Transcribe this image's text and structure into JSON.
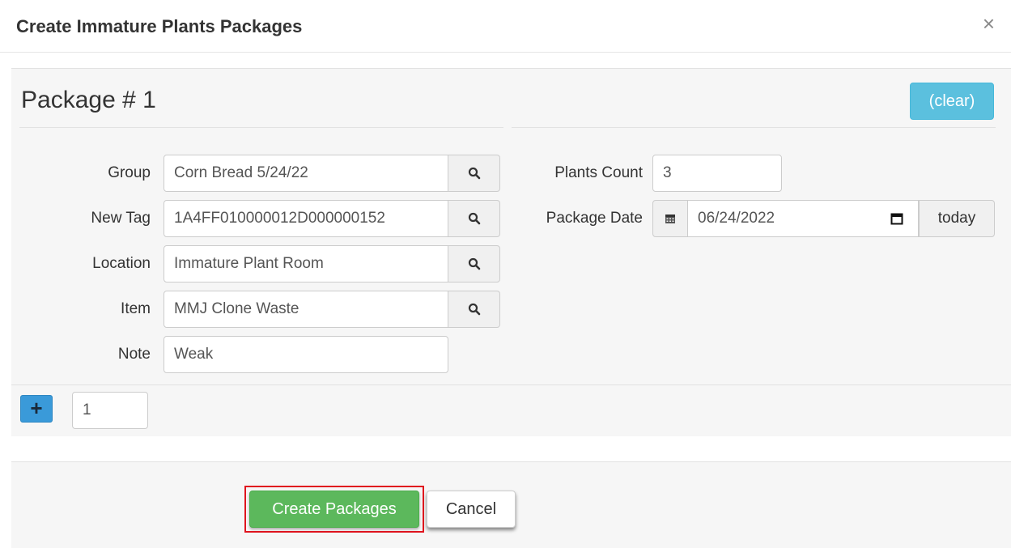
{
  "dialog": {
    "title": "Create Immature Plants Packages",
    "close_glyph": "×"
  },
  "package": {
    "title": "Package # 1",
    "clear_label": "(clear)",
    "fields": {
      "group": {
        "label": "Group",
        "value": "Corn Bread 5/24/22"
      },
      "new_tag": {
        "label": "New Tag",
        "value": "1A4FF010000012D000000152"
      },
      "location": {
        "label": "Location",
        "value": "Immature Plant Room"
      },
      "item": {
        "label": "Item",
        "value": "MMJ Clone Waste"
      },
      "note": {
        "label": "Note",
        "value": "Weak"
      },
      "plants_count": {
        "label": "Plants Count",
        "value": "3"
      },
      "package_date": {
        "label": "Package Date",
        "value": "06/24/2022",
        "today_label": "today"
      }
    }
  },
  "add_packages": {
    "plus_glyph": "+",
    "count": "1"
  },
  "footer": {
    "create_label": "Create Packages",
    "cancel_label": "Cancel"
  },
  "icons": {
    "lookup": "search-icon",
    "calendar": "calendar-icon",
    "date_picker": "calendar-picker-icon"
  },
  "colors": {
    "clear_button": "#5bc0de",
    "create_button": "#5cb85c",
    "plus_button": "#3a9ad9",
    "highlight": "#e0141e"
  }
}
